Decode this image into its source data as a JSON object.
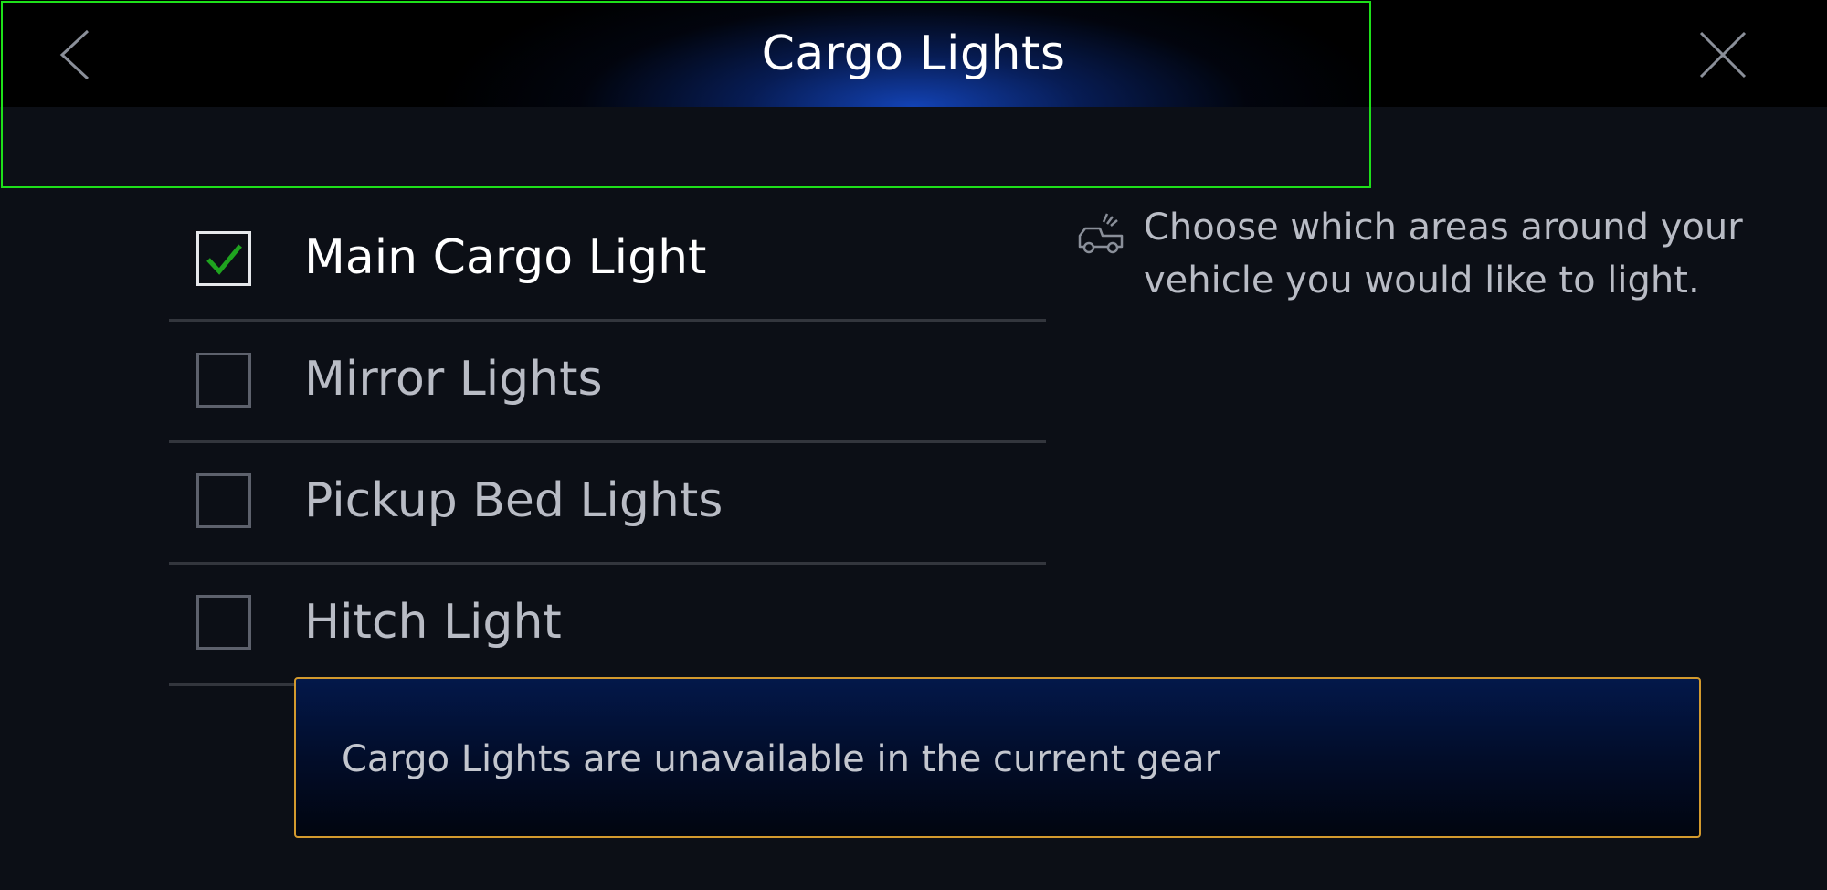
{
  "header": {
    "title": "Cargo Lights",
    "back_icon": "chevron-left-icon",
    "close_icon": "close-icon"
  },
  "options": [
    {
      "label": "Main Cargo Light",
      "checked": true
    },
    {
      "label": "Mirror Lights",
      "checked": false
    },
    {
      "label": "Pickup Bed Lights",
      "checked": false
    },
    {
      "label": "Hitch Light",
      "checked": false
    }
  ],
  "info": {
    "icon": "vehicle-light-icon",
    "text": "Choose which areas around your vehicle you would like to light."
  },
  "notice": {
    "text": "Cargo Lights are unavailable in the current gear",
    "border_color": "#d39a2e"
  },
  "colors": {
    "check_accent": "#1fa31f",
    "focus_outline": "#1ee01a"
  }
}
